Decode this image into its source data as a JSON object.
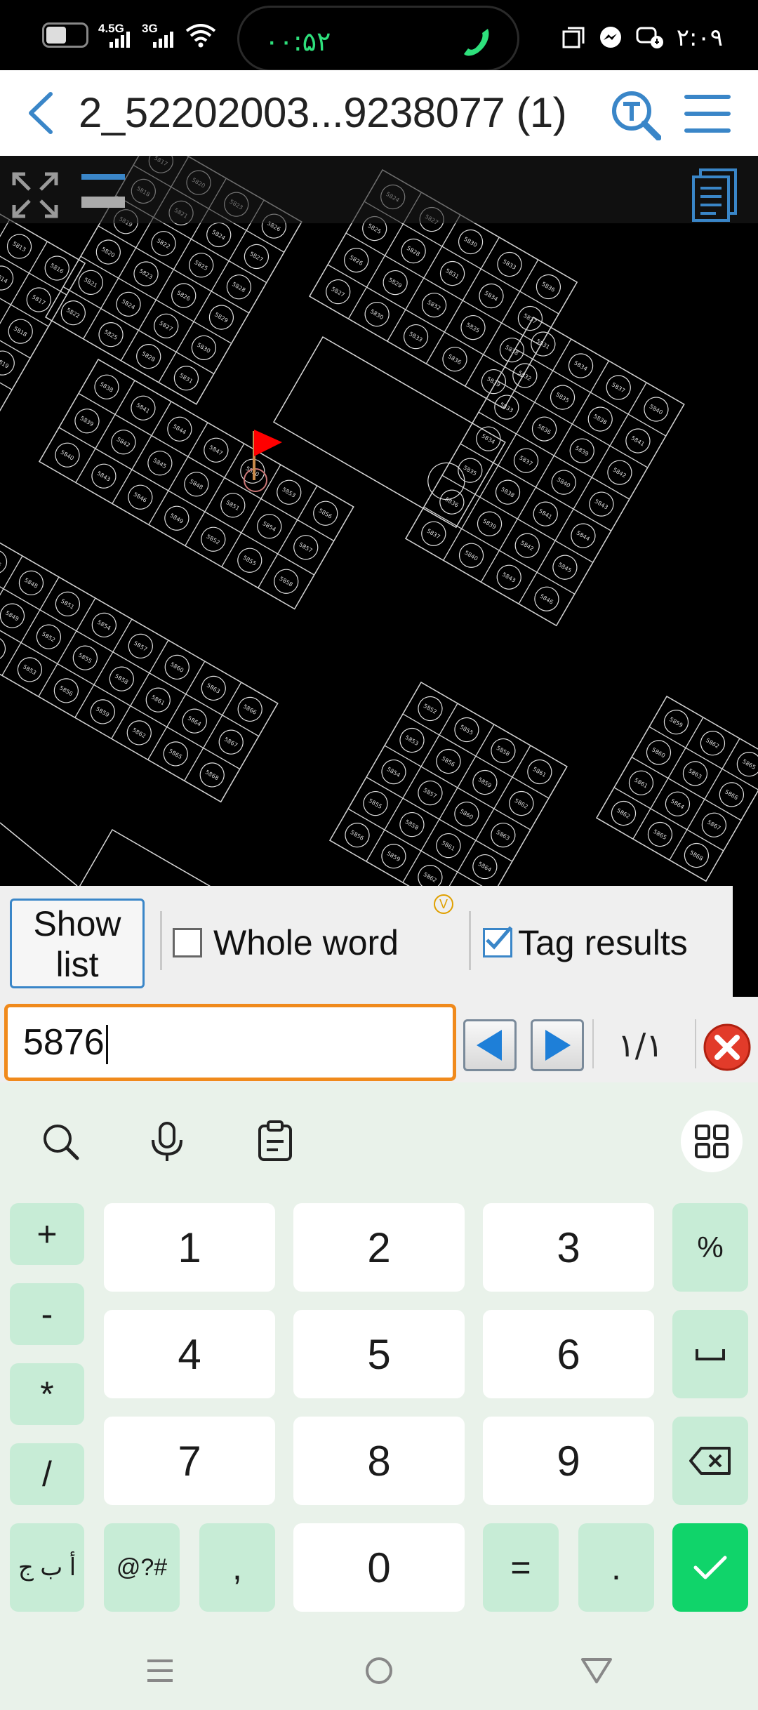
{
  "status_bar": {
    "network_1": "4.5G",
    "network_2": "3G",
    "call_timer": "۰۰:۵۲",
    "clock": "۲:۰۹"
  },
  "app_bar": {
    "title": "2_52202003...9238077 (1)",
    "icons": [
      "back-chevron-icon",
      "text-search-icon",
      "hamburger-menu-icon"
    ]
  },
  "canvas": {
    "flag_color": "#ff0000",
    "label_numbers": [
      "5876"
    ],
    "icons": [
      "fullscreen-expand-icon",
      "layers-icon",
      "notes-icon"
    ]
  },
  "find_options": {
    "show_list_label": "Show list",
    "whole_word": {
      "label": "Whole word",
      "checked": false
    },
    "tag_results": {
      "label": "Tag results",
      "checked": true
    },
    "badge": "V"
  },
  "find_bar": {
    "query": "5876",
    "result_count": "۱/۱",
    "icons": [
      "prev-triangle-icon",
      "next-triangle-icon",
      "close-red-x-icon"
    ]
  },
  "keyboard": {
    "tools": [
      "search-icon",
      "microphone-icon",
      "clipboard-icon",
      "grid-apps-icon"
    ],
    "left_ops": [
      "+",
      "-",
      "*",
      "/"
    ],
    "digits_row1": [
      "1",
      "2",
      "3"
    ],
    "digits_row2": [
      "4",
      "5",
      "6"
    ],
    "digits_row3": [
      "7",
      "8",
      "9"
    ],
    "right_ops": [
      "%",
      "␣",
      "⌫"
    ],
    "bottom_row": [
      "أ ب ج",
      "@?#",
      ",",
      "0",
      "=",
      ".",
      "✓"
    ],
    "accent_color": "#10d46a"
  },
  "nav_bar": {
    "icons": [
      "recents-icon",
      "home-icon",
      "back-icon"
    ]
  }
}
